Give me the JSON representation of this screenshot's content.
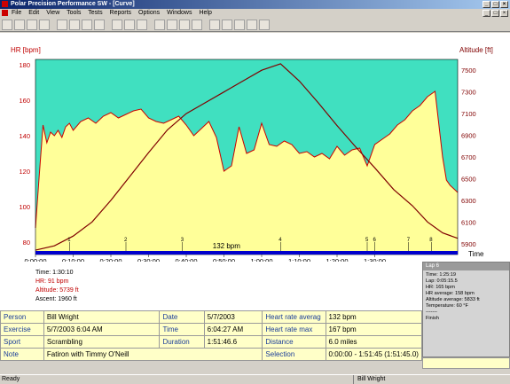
{
  "window": {
    "title": "Polar Precision Performance SW - [Curve]"
  },
  "menu": [
    "File",
    "Edit",
    "View",
    "Tools",
    "Tests",
    "Reports",
    "Options",
    "Windows",
    "Help"
  ],
  "toolbar": [
    "open",
    "save",
    "print",
    "preview",
    "person",
    "exercise",
    "calendar",
    "folder",
    "chart",
    "table",
    "bar",
    "search",
    "zoom",
    "zoom-out",
    "info",
    "bar-chart-1",
    "bar-chart-2",
    "bar-chart-3",
    "bar-chart-4",
    "bar-chart-5"
  ],
  "colors": {
    "hr_line": "#cc0000",
    "altitude_line": "#800000",
    "fill_yellow": "#ffff99",
    "fill_teal": "#40e0c0",
    "lap_bar": "#0000cc"
  },
  "chart_data": {
    "type": "line",
    "ylabel_left": "HR [bpm]",
    "ylabel_right": "Altitude [ft]",
    "xlabel": "Time",
    "left_ticks": [
      80,
      100,
      120,
      140,
      160,
      180
    ],
    "right_ticks": [
      5900,
      6100,
      6300,
      6500,
      6700,
      6900,
      7100,
      7300,
      7500
    ],
    "x_ticks": [
      "0:00:00",
      "0:10:00",
      "0:20:00",
      "0:30:00",
      "0:40:00",
      "0:50:00",
      "1:00:00",
      "1:10:00",
      "1:20:00",
      "1:30:00"
    ],
    "ylim_left": [
      73,
      183
    ],
    "ylim_right": [
      5800,
      7600
    ],
    "xlim_minutes": [
      0,
      112
    ],
    "threshold_label": "132 bpm",
    "threshold_bpm": 132,
    "lap_markers": [
      {
        "label": "1",
        "minute": 9
      },
      {
        "label": "2",
        "minute": 24
      },
      {
        "label": "3",
        "minute": 39
      },
      {
        "label": "4",
        "minute": 65
      },
      {
        "label": "5",
        "minute": 88
      },
      {
        "label": "6",
        "minute": 90
      },
      {
        "label": "7",
        "minute": 99
      },
      {
        "label": "8",
        "minute": 105
      }
    ],
    "series": [
      {
        "name": "HR",
        "x": [
          0,
          1,
          2,
          3,
          4,
          5,
          6,
          7,
          8,
          9,
          10,
          12,
          14,
          16,
          18,
          20,
          22,
          24,
          26,
          28,
          30,
          32,
          34,
          36,
          38,
          40,
          42,
          44,
          46,
          48,
          50,
          52,
          54,
          56,
          58,
          60,
          62,
          64,
          66,
          68,
          70,
          72,
          74,
          76,
          78,
          80,
          82,
          84,
          86,
          88,
          90,
          92,
          94,
          96,
          98,
          100,
          102,
          104,
          106,
          108,
          109,
          110,
          111,
          112
        ],
        "values": [
          88,
          118,
          146,
          136,
          142,
          140,
          143,
          139,
          145,
          147,
          143,
          148,
          150,
          147,
          151,
          153,
          150,
          152,
          154,
          155,
          150,
          148,
          147,
          149,
          151,
          146,
          140,
          144,
          148,
          139,
          120,
          123,
          145,
          130,
          132,
          147,
          135,
          134,
          137,
          135,
          130,
          131,
          128,
          130,
          127,
          134,
          129,
          132,
          133,
          123,
          135,
          138,
          141,
          146,
          149,
          154,
          157,
          162,
          165,
          128,
          115,
          112,
          110,
          108
        ]
      },
      {
        "name": "Altitude",
        "x": [
          0,
          5,
          10,
          15,
          20,
          25,
          30,
          35,
          40,
          45,
          50,
          55,
          60,
          65,
          70,
          75,
          80,
          85,
          90,
          95,
          100,
          104,
          108,
          112
        ],
        "values": [
          5840,
          5880,
          5970,
          6100,
          6300,
          6520,
          6740,
          6950,
          7100,
          7200,
          7300,
          7400,
          7500,
          7560,
          7400,
          7200,
          6990,
          6790,
          6600,
          6400,
          6250,
          6100,
          6000,
          5950
        ]
      }
    ]
  },
  "stats": {
    "time": "Time: 1:30:10",
    "hr": "HR: 91 bpm",
    "altitude": "Altitude: 5739 ft",
    "ascent": "Ascent: 1960 ft"
  },
  "lap_popup": {
    "title": "Lap 6",
    "lines": [
      "Time: 1:25:19",
      "Lap: 0:05:15.5",
      "HR: 165 bpm",
      "HR average: 158 bpm",
      "Altitude average: 5833 ft",
      "Temperature: 60 °F",
      "-------",
      "Finish"
    ]
  },
  "info": {
    "person_label": "Person",
    "person": "Bill Wright",
    "exercise_label": "Exercise",
    "exercise": "5/7/2003 6:04 AM",
    "sport_label": "Sport",
    "sport": "Scrambling",
    "note_label": "Note",
    "note": "Fatiron with Timmy O'Neill",
    "date_label": "Date",
    "date": "5/7/2003",
    "time_label": "Time",
    "time": "6:04:27 AM",
    "duration_label": "Duration",
    "duration": "1:51:46.6",
    "hr_avg_label": "Heart rate averag",
    "hr_avg": "132 bpm",
    "hr_max_label": "Heart rate max",
    "hr_max": "167 bpm",
    "distance_label": "Distance",
    "distance": "6.0 miles",
    "selection_label": "Selection",
    "selection": "0:00:00 - 1:51:45 (1:51:45.0)"
  },
  "statusbar": {
    "left": "Ready",
    "right": "Bill Wright"
  }
}
